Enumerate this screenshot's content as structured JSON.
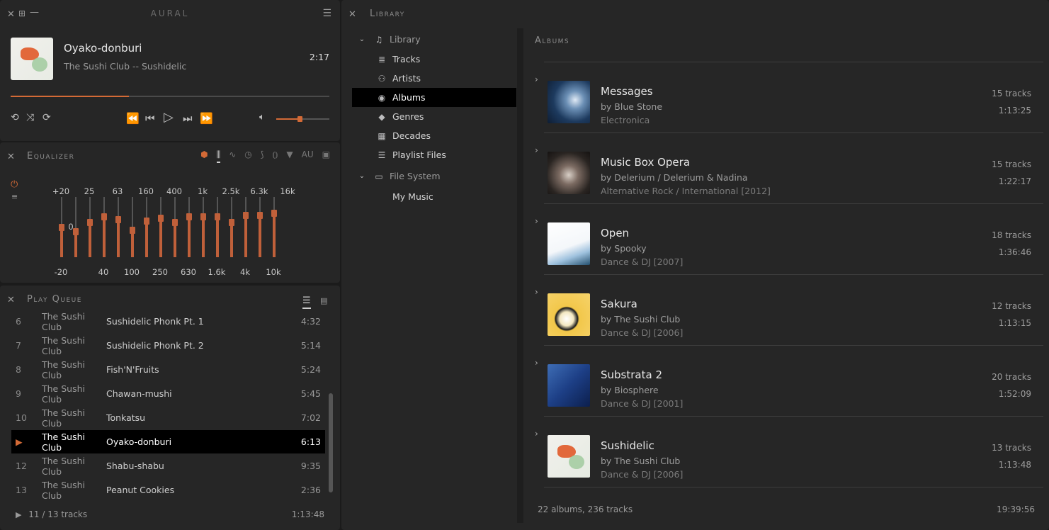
{
  "player": {
    "brand": "AURAL",
    "track_title": "Oyako-donburi",
    "track_subtitle": "The Sushi Club -- Sushidelic",
    "time": "2:17",
    "seek_progress": 0.37,
    "volume": 0.45
  },
  "equalizer": {
    "title": "Equalizer",
    "au_label": "AU",
    "zero_label": "0",
    "top_labels": [
      "+20",
      "25",
      "63",
      "160",
      "400",
      "1k",
      "2.5k",
      "6.3k",
      "16k"
    ],
    "bottom_labels": [
      "-20",
      "40",
      "100",
      "250",
      "630",
      "1.6k",
      "4k",
      "10k"
    ],
    "band_values_db": [
      0,
      -3,
      3,
      7,
      5,
      -2,
      4,
      6,
      3,
      7,
      7,
      7,
      3,
      8,
      8,
      9
    ]
  },
  "queue": {
    "title": "Play  Queue",
    "rows": [
      {
        "num": "6",
        "artist": "The Sushi Club",
        "title": "Sushidelic Phonk Pt. 1",
        "duration": "4:32"
      },
      {
        "num": "7",
        "artist": "The Sushi Club",
        "title": "Sushidelic Phonk Pt. 2",
        "duration": "5:14"
      },
      {
        "num": "8",
        "artist": "The Sushi Club",
        "title": "Fish'N'Fruits",
        "duration": "5:24"
      },
      {
        "num": "9",
        "artist": "The Sushi Club",
        "title": "Chawan-mushi",
        "duration": "5:45"
      },
      {
        "num": "10",
        "artist": "The Sushi Club",
        "title": "Tonkatsu",
        "duration": "7:02"
      },
      {
        "num": "",
        "artist": "The Sushi Club",
        "title": "Oyako-donburi",
        "duration": "6:13",
        "current": true
      },
      {
        "num": "12",
        "artist": "The Sushi Club",
        "title": "Shabu-shabu",
        "duration": "9:35"
      },
      {
        "num": "13",
        "artist": "The Sushi Club",
        "title": "Peanut Cookies",
        "duration": "2:36"
      }
    ],
    "footer_count": "11 / 13 tracks",
    "footer_total": "1:13:48"
  },
  "library": {
    "title": "Library",
    "tree": {
      "library_label": "Library",
      "items": [
        "Tracks",
        "Artists",
        "Albums",
        "Genres",
        "Decades",
        "Playlist Files"
      ],
      "selected": "Albums",
      "filesystem_label": "File System",
      "filesystem_items": [
        "My Music"
      ]
    },
    "albums_heading": "Albums",
    "albums": [
      {
        "title": "Messages",
        "by": "by Blue Stone",
        "genre": "Electronica",
        "tracks": "15 tracks",
        "duration": "1:13:25",
        "cover": "blue"
      },
      {
        "title": "Music Box Opera",
        "by": "by Delerium / Delerium & Nadina",
        "genre": "Alternative Rock / International  [2012]",
        "tracks": "15 tracks",
        "duration": "1:22:17",
        "cover": "dark"
      },
      {
        "title": "Open",
        "by": "by Spooky",
        "genre": "Dance & DJ  [2007]",
        "tracks": "18 tracks",
        "duration": "1:36:46",
        "cover": "white"
      },
      {
        "title": "Sakura",
        "by": "by The Sushi Club",
        "genre": "Dance & DJ  [2006]",
        "tracks": "12 tracks",
        "duration": "1:13:15",
        "cover": "yellow"
      },
      {
        "title": "Substrata 2",
        "by": "by Biosphere",
        "genre": "Dance & DJ  [2001]",
        "tracks": "20 tracks",
        "duration": "1:52:09",
        "cover": "deepblue"
      },
      {
        "title": "Sushidelic",
        "by": "by The Sushi Club",
        "genre": "Dance & DJ  [2006]",
        "tracks": "13 tracks",
        "duration": "1:13:48",
        "cover": "sushi"
      }
    ],
    "footer_summary": "22 albums, 236 tracks",
    "footer_clock": "19:39:56"
  }
}
